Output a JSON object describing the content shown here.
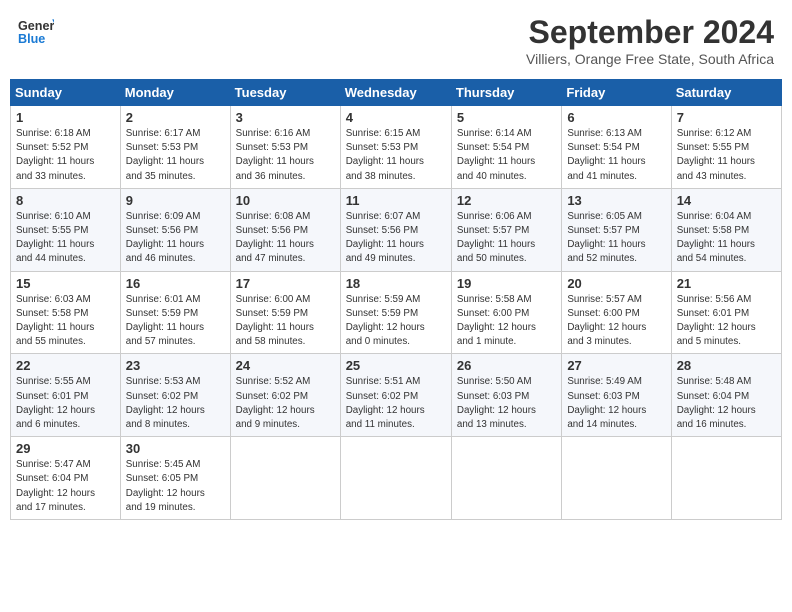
{
  "header": {
    "logo_general": "General",
    "logo_blue": "Blue",
    "month": "September 2024",
    "location": "Villiers, Orange Free State, South Africa"
  },
  "weekdays": [
    "Sunday",
    "Monday",
    "Tuesday",
    "Wednesday",
    "Thursday",
    "Friday",
    "Saturday"
  ],
  "weeks": [
    [
      {
        "day": "1",
        "info": "Sunrise: 6:18 AM\nSunset: 5:52 PM\nDaylight: 11 hours\nand 33 minutes."
      },
      {
        "day": "2",
        "info": "Sunrise: 6:17 AM\nSunset: 5:53 PM\nDaylight: 11 hours\nand 35 minutes."
      },
      {
        "day": "3",
        "info": "Sunrise: 6:16 AM\nSunset: 5:53 PM\nDaylight: 11 hours\nand 36 minutes."
      },
      {
        "day": "4",
        "info": "Sunrise: 6:15 AM\nSunset: 5:53 PM\nDaylight: 11 hours\nand 38 minutes."
      },
      {
        "day": "5",
        "info": "Sunrise: 6:14 AM\nSunset: 5:54 PM\nDaylight: 11 hours\nand 40 minutes."
      },
      {
        "day": "6",
        "info": "Sunrise: 6:13 AM\nSunset: 5:54 PM\nDaylight: 11 hours\nand 41 minutes."
      },
      {
        "day": "7",
        "info": "Sunrise: 6:12 AM\nSunset: 5:55 PM\nDaylight: 11 hours\nand 43 minutes."
      }
    ],
    [
      {
        "day": "8",
        "info": "Sunrise: 6:10 AM\nSunset: 5:55 PM\nDaylight: 11 hours\nand 44 minutes."
      },
      {
        "day": "9",
        "info": "Sunrise: 6:09 AM\nSunset: 5:56 PM\nDaylight: 11 hours\nand 46 minutes."
      },
      {
        "day": "10",
        "info": "Sunrise: 6:08 AM\nSunset: 5:56 PM\nDaylight: 11 hours\nand 47 minutes."
      },
      {
        "day": "11",
        "info": "Sunrise: 6:07 AM\nSunset: 5:56 PM\nDaylight: 11 hours\nand 49 minutes."
      },
      {
        "day": "12",
        "info": "Sunrise: 6:06 AM\nSunset: 5:57 PM\nDaylight: 11 hours\nand 50 minutes."
      },
      {
        "day": "13",
        "info": "Sunrise: 6:05 AM\nSunset: 5:57 PM\nDaylight: 11 hours\nand 52 minutes."
      },
      {
        "day": "14",
        "info": "Sunrise: 6:04 AM\nSunset: 5:58 PM\nDaylight: 11 hours\nand 54 minutes."
      }
    ],
    [
      {
        "day": "15",
        "info": "Sunrise: 6:03 AM\nSunset: 5:58 PM\nDaylight: 11 hours\nand 55 minutes."
      },
      {
        "day": "16",
        "info": "Sunrise: 6:01 AM\nSunset: 5:59 PM\nDaylight: 11 hours\nand 57 minutes."
      },
      {
        "day": "17",
        "info": "Sunrise: 6:00 AM\nSunset: 5:59 PM\nDaylight: 11 hours\nand 58 minutes."
      },
      {
        "day": "18",
        "info": "Sunrise: 5:59 AM\nSunset: 5:59 PM\nDaylight: 12 hours\nand 0 minutes."
      },
      {
        "day": "19",
        "info": "Sunrise: 5:58 AM\nSunset: 6:00 PM\nDaylight: 12 hours\nand 1 minute."
      },
      {
        "day": "20",
        "info": "Sunrise: 5:57 AM\nSunset: 6:00 PM\nDaylight: 12 hours\nand 3 minutes."
      },
      {
        "day": "21",
        "info": "Sunrise: 5:56 AM\nSunset: 6:01 PM\nDaylight: 12 hours\nand 5 minutes."
      }
    ],
    [
      {
        "day": "22",
        "info": "Sunrise: 5:55 AM\nSunset: 6:01 PM\nDaylight: 12 hours\nand 6 minutes."
      },
      {
        "day": "23",
        "info": "Sunrise: 5:53 AM\nSunset: 6:02 PM\nDaylight: 12 hours\nand 8 minutes."
      },
      {
        "day": "24",
        "info": "Sunrise: 5:52 AM\nSunset: 6:02 PM\nDaylight: 12 hours\nand 9 minutes."
      },
      {
        "day": "25",
        "info": "Sunrise: 5:51 AM\nSunset: 6:02 PM\nDaylight: 12 hours\nand 11 minutes."
      },
      {
        "day": "26",
        "info": "Sunrise: 5:50 AM\nSunset: 6:03 PM\nDaylight: 12 hours\nand 13 minutes."
      },
      {
        "day": "27",
        "info": "Sunrise: 5:49 AM\nSunset: 6:03 PM\nDaylight: 12 hours\nand 14 minutes."
      },
      {
        "day": "28",
        "info": "Sunrise: 5:48 AM\nSunset: 6:04 PM\nDaylight: 12 hours\nand 16 minutes."
      }
    ],
    [
      {
        "day": "29",
        "info": "Sunrise: 5:47 AM\nSunset: 6:04 PM\nDaylight: 12 hours\nand 17 minutes."
      },
      {
        "day": "30",
        "info": "Sunrise: 5:45 AM\nSunset: 6:05 PM\nDaylight: 12 hours\nand 19 minutes."
      },
      null,
      null,
      null,
      null,
      null
    ]
  ]
}
